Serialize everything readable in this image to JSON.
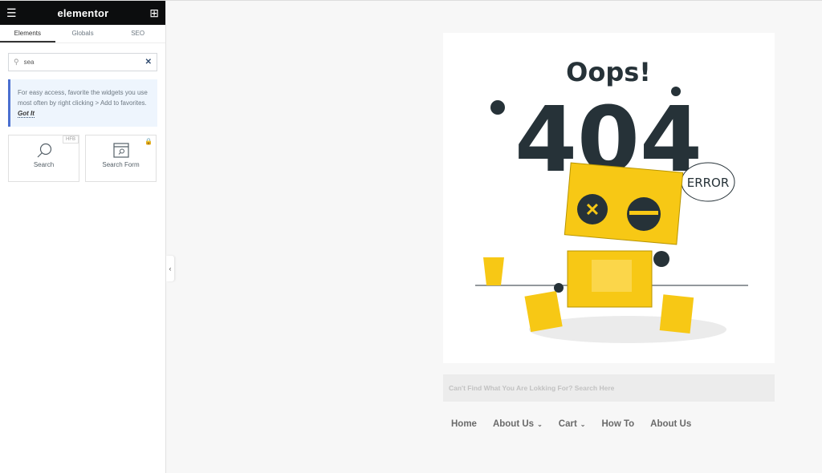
{
  "panel": {
    "logo": "elementor",
    "tabs": [
      {
        "label": "Elements",
        "active": true
      },
      {
        "label": "Globals"
      },
      {
        "label": "SEO"
      }
    ],
    "search": {
      "value": "sea"
    },
    "tip": {
      "text": "For easy access, favorite the widgets you use most often by right clicking > Add to favorites.",
      "link": "Got It"
    },
    "widgets": [
      {
        "label": "Search",
        "badge": "HFB",
        "icon": "magnifier-icon"
      },
      {
        "label": "Search Form",
        "icon": "search-form-icon",
        "locked": true
      }
    ]
  },
  "page": {
    "illustration": {
      "oops": "Oops!",
      "code": "404",
      "error": "ERROR"
    },
    "search_placeholder": "Can't Find What You Are Lokking For? Search Here",
    "nav": [
      {
        "label": "Home"
      },
      {
        "label": "About Us",
        "dropdown": true
      },
      {
        "label": "Cart",
        "dropdown": true
      },
      {
        "label": "How To"
      },
      {
        "label": "About Us"
      }
    ]
  },
  "colors": {
    "accent": "#f7c815",
    "dark": "#263238",
    "tip_border": "#4b6fd0"
  }
}
